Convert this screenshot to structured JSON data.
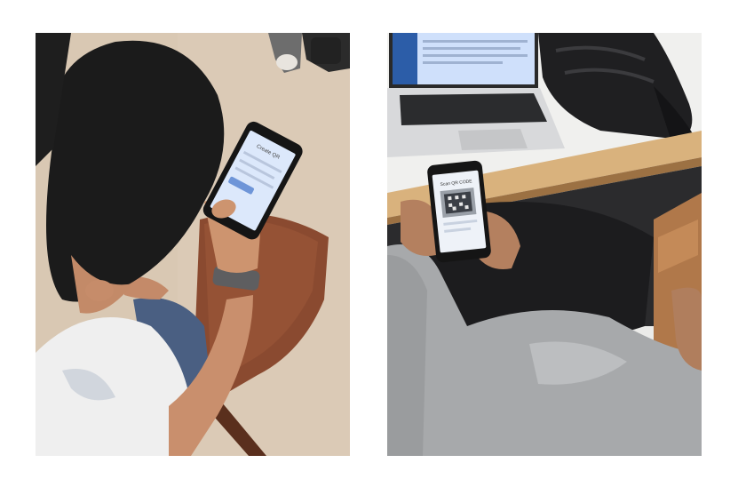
{
  "photos": [
    {
      "phone_screen_title": "Create QR"
    },
    {
      "phone_screen_title": "Scan QR CODE"
    }
  ],
  "colors": {
    "floor": "#d9c8b3",
    "chair_wood": "#8a4a30",
    "hair": "#1b1b1b",
    "phone_screen": "#dce8fb",
    "laptop_screen": "#cfe0fb",
    "hoodie_grey": "#a7a9ab",
    "desk_edge": "#d9b27d"
  }
}
